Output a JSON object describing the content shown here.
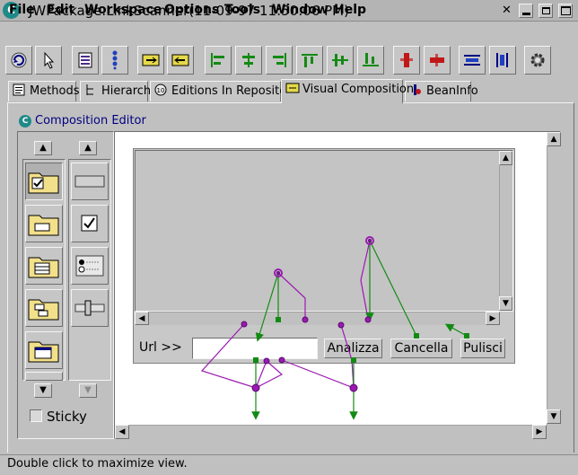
{
  "window": {
    "title": "JWPackage.LinkScanner(11-09-97 11:50:06 PM)",
    "app_icon_letter": "C"
  },
  "menu": [
    "File",
    "Edit",
    "Workspace",
    "Options",
    "Tools",
    "Window",
    "Help"
  ],
  "toolbar": {
    "icons": [
      "refresh-icon",
      "select-pointer-icon",
      "list-icon",
      "vertical-list-icon",
      "bean-icon",
      "bean-alt-icon",
      "align-left-icon",
      "align-center-icon",
      "align-right-icon",
      "align-top-icon",
      "align-middle-icon",
      "align-bottom-icon",
      "match-width-icon",
      "match-height-icon",
      "distribute-horizontal-icon",
      "distribute-vertical-icon",
      "settings-gear-icon"
    ]
  },
  "tabs": [
    {
      "label": "Methods",
      "icon": "methods-icon"
    },
    {
      "label": "Hierarchy",
      "icon": "hierarchy-icon"
    },
    {
      "label": "Editions In Repository",
      "icon": "editions-icon"
    },
    {
      "label": "Visual Composition",
      "icon": "visual-composition-icon",
      "active": true
    },
    {
      "label": "BeanInfo",
      "icon": "beaninfo-icon"
    }
  ],
  "editor": {
    "title": "Composition Editor",
    "icon_letter": "C",
    "sticky_label": "Sticky"
  },
  "form": {
    "url_label": "Url >>",
    "url_value": "",
    "buttons": [
      "Analizza",
      "Cancella",
      "Pulisci"
    ]
  },
  "status": {
    "text": "Double click to maximize view."
  },
  "colors": {
    "connection_green": "#138a13",
    "connection_purple": "#9a1ab0",
    "title_bar": "#b4b4b4"
  }
}
